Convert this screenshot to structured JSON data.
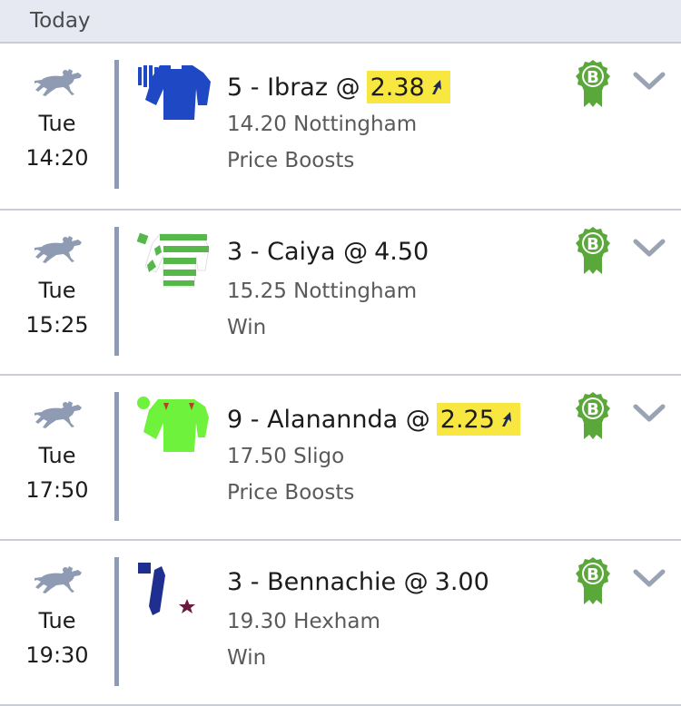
{
  "header": {
    "title": "Today"
  },
  "icons": {
    "sport": "horse-racing-icon",
    "badge": "bet-builder-badge-icon",
    "badge_letter": "B",
    "expand": "chevron-down-icon",
    "boost": "price-boost-arrow-icon"
  },
  "colors": {
    "header_bg": "#e6e9f2",
    "divider": "#8e9bb3",
    "boost_highlight": "#f8e641",
    "badge_green": "#5aa83a",
    "icon_grey": "#8e9bb3"
  },
  "bets": [
    {
      "day": "Tue",
      "time": "14:20",
      "runner": "5 - Ibraz @",
      "price": "2.38",
      "boosted": true,
      "race": "14.20 Nottingham",
      "market": "Price Boosts"
    },
    {
      "day": "Tue",
      "time": "15:25",
      "runner": "3 - Caiya @",
      "price": "4.50",
      "boosted": false,
      "race": "15.25 Nottingham",
      "market": "Win"
    },
    {
      "day": "Tue",
      "time": "17:50",
      "runner": "9 - Alanannda @",
      "price": "2.25",
      "boosted": true,
      "race": "17.50 Sligo",
      "market": "Price Boosts"
    },
    {
      "day": "Tue",
      "time": "19:30",
      "runner": "3 - Bennachie @",
      "price": "3.00",
      "boosted": false,
      "race": "19.30 Hexham",
      "market": "Win"
    }
  ]
}
